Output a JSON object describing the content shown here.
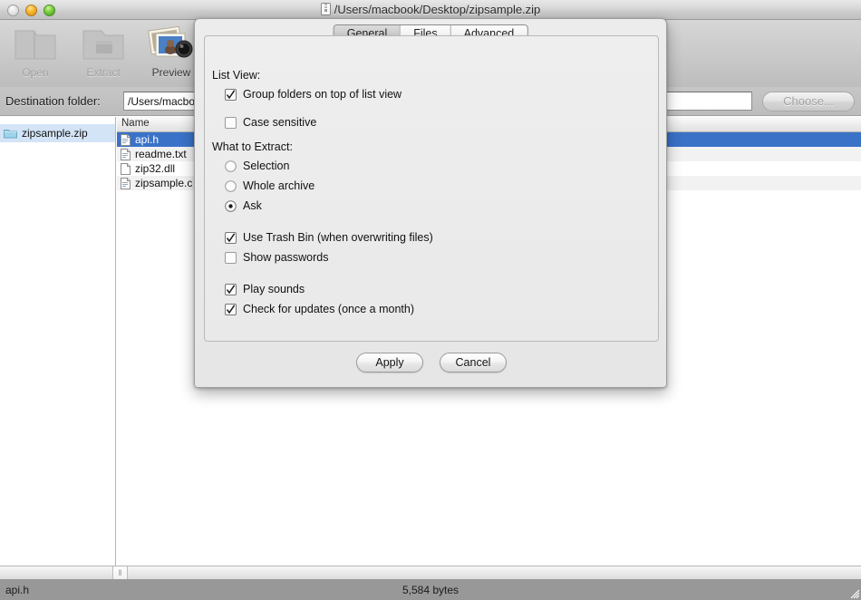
{
  "window": {
    "title": "/Users/macbook/Desktop/zipsample.zip",
    "title_icon": "archive-document-icon",
    "traffic_lights": {
      "close": "close-button",
      "minimize": "minimize-button",
      "zoom": "zoom-button"
    }
  },
  "toolbar": {
    "items": [
      {
        "label": "Open",
        "icon": "open-folder-icon",
        "enabled": false
      },
      {
        "label": "Extract",
        "icon": "extract-folder-icon",
        "enabled": false
      },
      {
        "label": "Preview",
        "icon": "preview-photos-icon",
        "enabled": true
      }
    ]
  },
  "destination": {
    "label": "Destination folder:",
    "value": "/Users/macbook/Desktop",
    "choose_label": "Choose...",
    "choose_enabled": false
  },
  "sidebar": {
    "items": [
      {
        "label": "zipsample.zip",
        "icon": "folder-icon",
        "selected": true
      }
    ]
  },
  "file_list": {
    "columns": [
      "Name"
    ],
    "rows": [
      {
        "name": "api.h",
        "icon": "file-text-icon",
        "selected": true
      },
      {
        "name": "readme.txt",
        "icon": "file-text-icon",
        "selected": false
      },
      {
        "name": "zip32.dll",
        "icon": "file-blank-icon",
        "selected": false
      },
      {
        "name": "zipsample.c",
        "icon": "file-text-icon",
        "selected": false
      }
    ]
  },
  "statusbar": {
    "left": "api.h",
    "center": "5,584 bytes"
  },
  "dialog": {
    "tabs": [
      {
        "label": "General",
        "active": true
      },
      {
        "label": "Files",
        "active": false
      },
      {
        "label": "Advanced",
        "active": false
      }
    ],
    "list_view": {
      "group_label": "List View:",
      "options": [
        {
          "label": "Group folders on top of list view",
          "type": "checkbox",
          "checked": true
        },
        {
          "label": "Case sensitive",
          "type": "checkbox",
          "checked": false
        }
      ]
    },
    "what_to_extract": {
      "group_label": "What to Extract:",
      "options": [
        {
          "label": "Selection",
          "type": "radio",
          "checked": false
        },
        {
          "label": "Whole archive",
          "type": "radio",
          "checked": false
        },
        {
          "label": "Ask",
          "type": "radio",
          "checked": true
        }
      ]
    },
    "misc": [
      {
        "label": "Use Trash Bin (when overwriting files)",
        "type": "checkbox",
        "checked": true
      },
      {
        "label": "Show passwords",
        "type": "checkbox",
        "checked": false
      }
    ],
    "misc2": [
      {
        "label": "Play sounds",
        "type": "checkbox",
        "checked": true
      },
      {
        "label": "Check for updates (once a month)",
        "type": "checkbox",
        "checked": true
      }
    ],
    "buttons": {
      "apply": "Apply",
      "cancel": "Cancel"
    }
  },
  "colors": {
    "selection_blue": "#3a72c8",
    "sidebar_selection": "#d4e4f7",
    "statusbar_gray": "#989898"
  }
}
